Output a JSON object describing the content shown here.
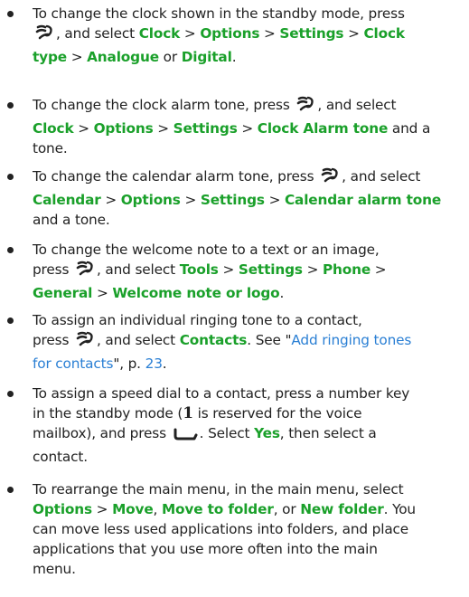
{
  "bullets": [
    {
      "lines": [
        [
          {
            "t": "To change the clock shown in the standby mode, press"
          }
        ],
        [
          {
            "icon": "menu-key-icon"
          },
          {
            "t": ", and select "
          },
          {
            "t": "Clock",
            "c": "g"
          },
          {
            "t": " > "
          },
          {
            "t": "Options",
            "c": "g"
          },
          {
            "t": " > "
          },
          {
            "t": "Settings",
            "c": "g"
          },
          {
            "t": " > "
          },
          {
            "t": "Clock",
            "c": "g"
          }
        ],
        [
          {
            "t": "type",
            "c": "g"
          },
          {
            "t": " > "
          },
          {
            "t": "Analogue",
            "c": "g"
          },
          {
            "t": " or "
          },
          {
            "t": "Digital",
            "c": "g"
          },
          {
            "t": "."
          }
        ]
      ]
    },
    {
      "lines": [
        [
          {
            "t": "To change the clock alarm tone, press "
          },
          {
            "icon": "menu-key-icon"
          },
          {
            "t": ", and select"
          }
        ],
        [
          {
            "t": "Clock",
            "c": "g"
          },
          {
            "t": " > "
          },
          {
            "t": "Options",
            "c": "g"
          },
          {
            "t": " > "
          },
          {
            "t": "Settings",
            "c": "g"
          },
          {
            "t": " > "
          },
          {
            "t": "Clock Alarm tone",
            "c": "g"
          },
          {
            "t": " and a"
          }
        ],
        [
          {
            "t": "tone."
          }
        ]
      ]
    },
    {
      "lines": [
        [
          {
            "t": "To change the calendar alarm tone, press "
          },
          {
            "icon": "menu-key-icon"
          },
          {
            "t": ", and select"
          }
        ],
        [
          {
            "t": "Calendar",
            "c": "g"
          },
          {
            "t": " > "
          },
          {
            "t": "Options",
            "c": "g"
          },
          {
            "t": " > "
          },
          {
            "t": "Settings",
            "c": "g"
          },
          {
            "t": " > "
          },
          {
            "t": "Calendar alarm tone",
            "c": "g"
          }
        ],
        [
          {
            "t": "and a tone."
          }
        ]
      ]
    },
    {
      "lines": [
        [
          {
            "t": "To change the welcome note to a text or an image,"
          }
        ],
        [
          {
            "t": "press "
          },
          {
            "icon": "menu-key-icon"
          },
          {
            "t": ", and select "
          },
          {
            "t": "Tools",
            "c": "g"
          },
          {
            "t": " > "
          },
          {
            "t": "Settings",
            "c": "g"
          },
          {
            "t": " > "
          },
          {
            "t": "Phone",
            "c": "g"
          },
          {
            "t": " >"
          }
        ],
        [
          {
            "t": "General",
            "c": "g"
          },
          {
            "t": " > "
          },
          {
            "t": "Welcome note or logo",
            "c": "g"
          },
          {
            "t": "."
          }
        ]
      ]
    },
    {
      "lines": [
        [
          {
            "t": "To assign an individual ringing tone to a contact,"
          }
        ],
        [
          {
            "t": "press "
          },
          {
            "icon": "menu-key-icon"
          },
          {
            "t": ", and select "
          },
          {
            "t": "Contacts",
            "c": "g"
          },
          {
            "t": ". See \""
          },
          {
            "t": "Add ringing tones",
            "c": "lk",
            "link": true
          }
        ],
        [
          {
            "t": "for contacts",
            "c": "lk",
            "link": true
          },
          {
            "t": "\", p. "
          },
          {
            "t": "23",
            "c": "lk",
            "link": true
          },
          {
            "t": "."
          }
        ]
      ]
    },
    {
      "lines": [
        [
          {
            "t": "To assign a speed dial to a contact, press a number key"
          }
        ],
        [
          {
            "t": "in the standby mode ("
          },
          {
            "t": "1",
            "c": "digit"
          },
          {
            "t": " is reserved for the voice"
          }
        ],
        [
          {
            "t": "mailbox), and press "
          },
          {
            "icon": "call-key-icon"
          },
          {
            "t": ". Select "
          },
          {
            "t": "Yes",
            "c": "g"
          },
          {
            "t": ", then select a"
          }
        ],
        [
          {
            "t": "contact."
          }
        ]
      ]
    },
    {
      "lines": [
        [
          {
            "t": "To rearrange the main menu, in the main menu, select"
          }
        ],
        [
          {
            "t": "Options",
            "c": "g"
          },
          {
            "t": " > "
          },
          {
            "t": "Move",
            "c": "g"
          },
          {
            "t": ", "
          },
          {
            "t": "Move to folder",
            "c": "g"
          },
          {
            "t": ", or "
          },
          {
            "t": "New folder",
            "c": "g"
          },
          {
            "t": ". You"
          }
        ],
        [
          {
            "t": "can move less used applications into folders, and place"
          }
        ],
        [
          {
            "t": "applications that you use more often into the main"
          }
        ],
        [
          {
            "t": "menu."
          }
        ]
      ]
    }
  ]
}
